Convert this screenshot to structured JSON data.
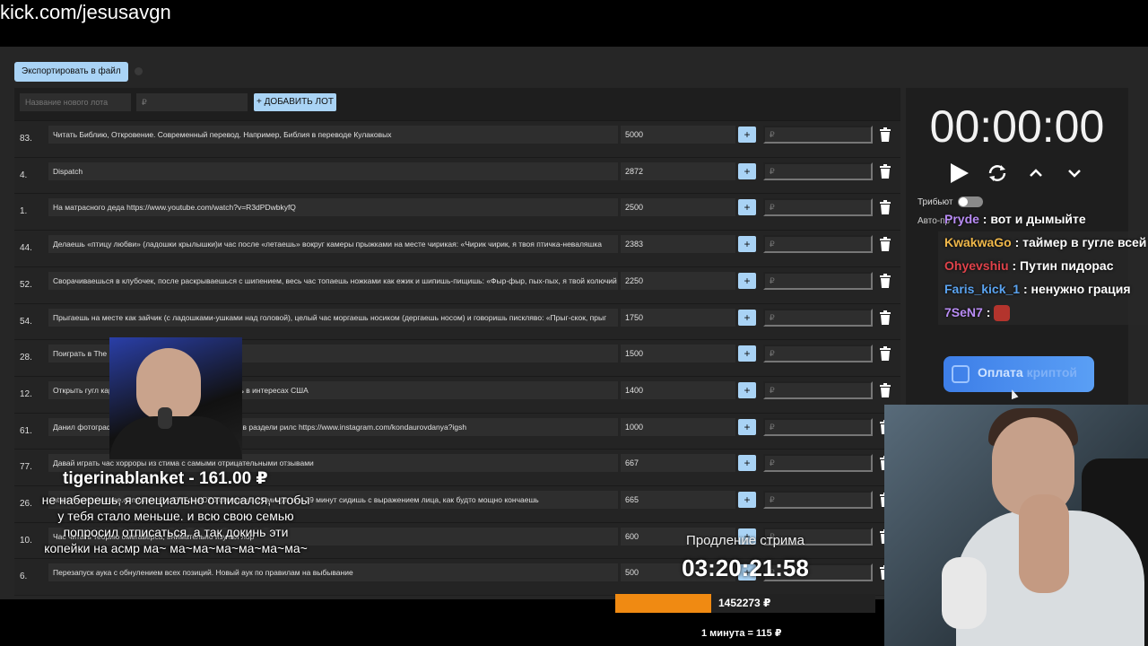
{
  "browser": {
    "url": "kick.com/jesusavgn"
  },
  "toolbar": {
    "export_label": "Экспортировать в файл"
  },
  "new_lot": {
    "name_placeholder": "Название нового лота",
    "price_placeholder": "₽",
    "add_label": "+ ДОБАВИТЬ ЛОТ"
  },
  "lots": [
    {
      "num": "83.",
      "name": "Читать Библию, Откровение. Современный перевод. Например, Библия в переводе Кулаковых",
      "amount": "5000"
    },
    {
      "num": "4.",
      "name": "Dispatch",
      "amount": "2872"
    },
    {
      "num": "1.",
      "name": "На матрасного деда https://www.youtube.com/watch?v=R3dPDwbkyfQ",
      "amount": "2500"
    },
    {
      "num": "44.",
      "name": "Делаешь «птицу любви» (ладошки крылышки)и час после «летаешь» вокруг камеры прыжками на месте чирикая: «Чирик чирик, я твоя птичка-неваляшка",
      "amount": "2383"
    },
    {
      "num": "52.",
      "name": "Сворачиваешься в клубочек, после раскрываешься с шипением, весь час топаешь ножками как ежик и шипишь-пищишь: «Фыр-фыр, пых-пых, я твой колючий",
      "amount": "2250"
    },
    {
      "num": "54.",
      "name": "Прыгаешь на месте как зайчик (с ладошками-ушками над головой), целый час моргаешь носиком (дергаешь носом) и говоришь писклявo: «Прыг-скок, прыг",
      "amount": "1750"
    },
    {
      "num": "28.",
      "name": "Поиграть в The Lo",
      "amount": "1500"
    },
    {
      "num": "12.",
      "name": "Открыть гугл карт                                                            ледующую страну нужно отвоевать в интересах США",
      "amount": "1400"
    },
    {
      "num": "61.",
      "name": "Данил фотограф                                                                  мам И посмотрети первые 3 рилса, в раздели рилс https://www.instagram.com/kondaurovdanya?igsh",
      "amount": "1000"
    },
    {
      "num": "77.",
      "name": "Давай играть час хорроры из стима с самыми отрицательными отзывами",
      "amount": "667"
    },
    {
      "num": "26.",
      "name": "https://www.youtube.com/watch?v=5W7du4iDZ0 смотришь 29 минут. все 29 минут сидишь с выражением лица, как будто мощно кончаешь",
      "amount": "665"
    },
    {
      "num": "10.",
      "name": "Час читать теорию омегаверса, внимательно изучая лор",
      "amount": "600"
    },
    {
      "num": "6.",
      "name": "Перезапуск аука с обнулением всех позиций. Новый аук по правилам на выбывание",
      "amount": "500"
    }
  ],
  "lot_rub_placeholder": "₽",
  "lot_plus": "+",
  "timer": {
    "display": "00:00:00",
    "tribute_label": "Трибьют",
    "auto_label": "Авто-пр"
  },
  "chat": [
    {
      "user": "Pryde",
      "color": "#b98cf5",
      "msg": "вот и дымыйте"
    },
    {
      "user": "KwakwaGo",
      "color": "#f0b84a",
      "msg": "таймер в гугле всей"
    },
    {
      "user": "Ohyevshiu",
      "color": "#e0424a",
      "msg": "Путин пидорас"
    },
    {
      "user": "Faris_kick_1",
      "color": "#5aa3f0",
      "msg": "ненужно грация"
    },
    {
      "user": "7SeN7",
      "color": "#b98cf5",
      "msg": ""
    }
  ],
  "crypto": {
    "label_a": "Оплата",
    "label_b": "криптой"
  },
  "donation": {
    "title": "tigerinablanket - 161.00 ₽",
    "text": "не наберешь, я специально отписался, чтобы у тебя стало меньше. и всю свою семью попросил отписаться. а так докинь эти копейки на асмр ма~ ма~ма~ма~ма~ма~ма~"
  },
  "extension": {
    "label": "Продление стрима",
    "time": "03:20:21:58"
  },
  "progress": {
    "value_text": "1452273 ₽",
    "fill_fraction": 0.37,
    "color": "#f08a12"
  },
  "rate": "1 минута = 115 ₽"
}
